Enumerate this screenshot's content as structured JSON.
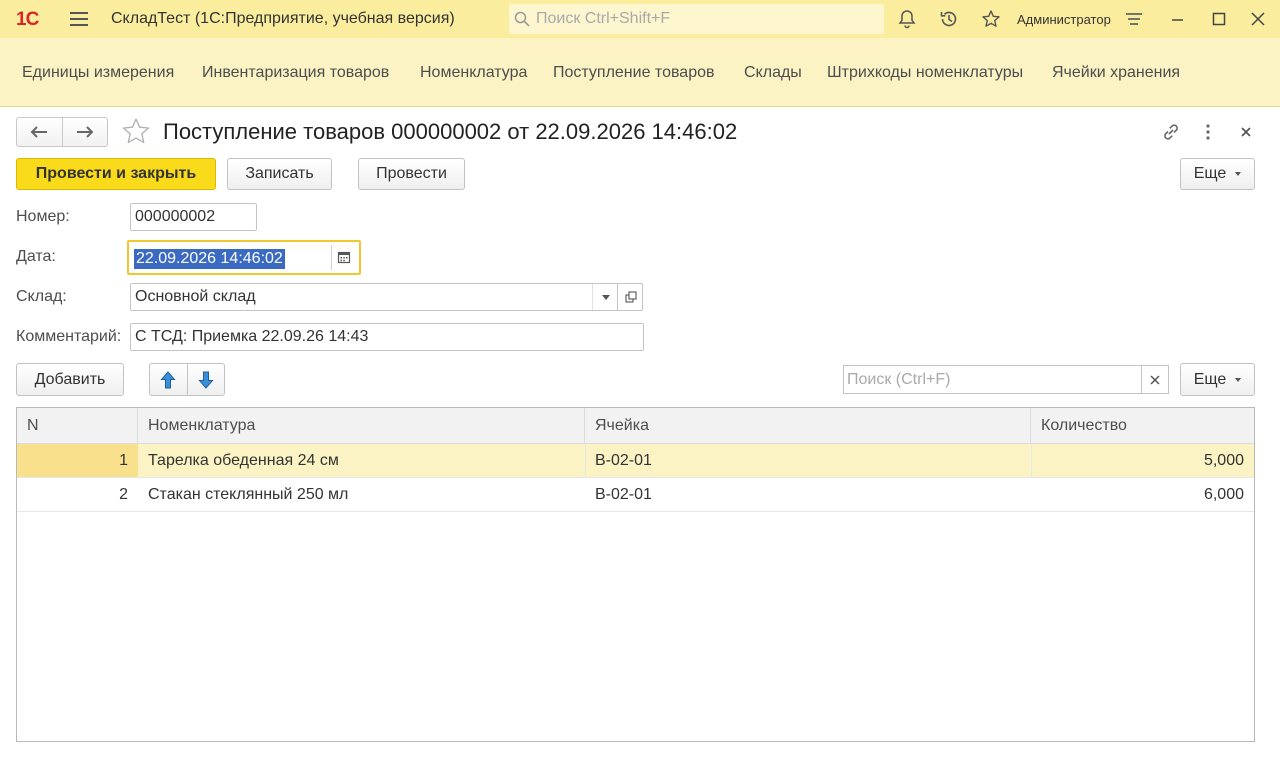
{
  "titlebar": {
    "logo": "1С",
    "app_title": "СкладТест  (1С:Предприятие, учебная версия)",
    "search_placeholder": "Поиск Ctrl+Shift+F",
    "user": "Администратор"
  },
  "sections": [
    "Единицы измерения",
    "Инвентаризация товаров",
    "Номенклатура",
    "Поступление товаров",
    "Склады",
    "Штрихкоды номенклатуры",
    "Ячейки хранения"
  ],
  "form": {
    "title": "Поступление товаров 000000002 от 22.09.2026 14:46:02",
    "buttons": {
      "post_close": "Провести и закрыть",
      "save": "Записать",
      "post": "Провести",
      "more": "Еще"
    },
    "fields": {
      "number_label": "Номер:",
      "number_value": "000000002",
      "date_label": "Дата:",
      "date_value": "22.09.2026 14:46:02",
      "warehouse_label": "Склад:",
      "warehouse_value": "Основной склад",
      "comment_label": "Комментарий:",
      "comment_value": "С ТСД: Приемка 22.09.26 14:43"
    }
  },
  "table_toolbar": {
    "add": "Добавить",
    "search_placeholder": "Поиск (Ctrl+F)",
    "more": "Еще"
  },
  "table": {
    "columns": [
      "N",
      "Номенклатура",
      "Ячейка",
      "Количество"
    ],
    "rows": [
      {
        "n": "1",
        "item": "Тарелка обеденная 24 см",
        "cell": "B-02-01",
        "qty": "5,000"
      },
      {
        "n": "2",
        "item": "Стакан стеклянный 250 мл",
        "cell": "B-02-01",
        "qty": "6,000"
      }
    ]
  }
}
